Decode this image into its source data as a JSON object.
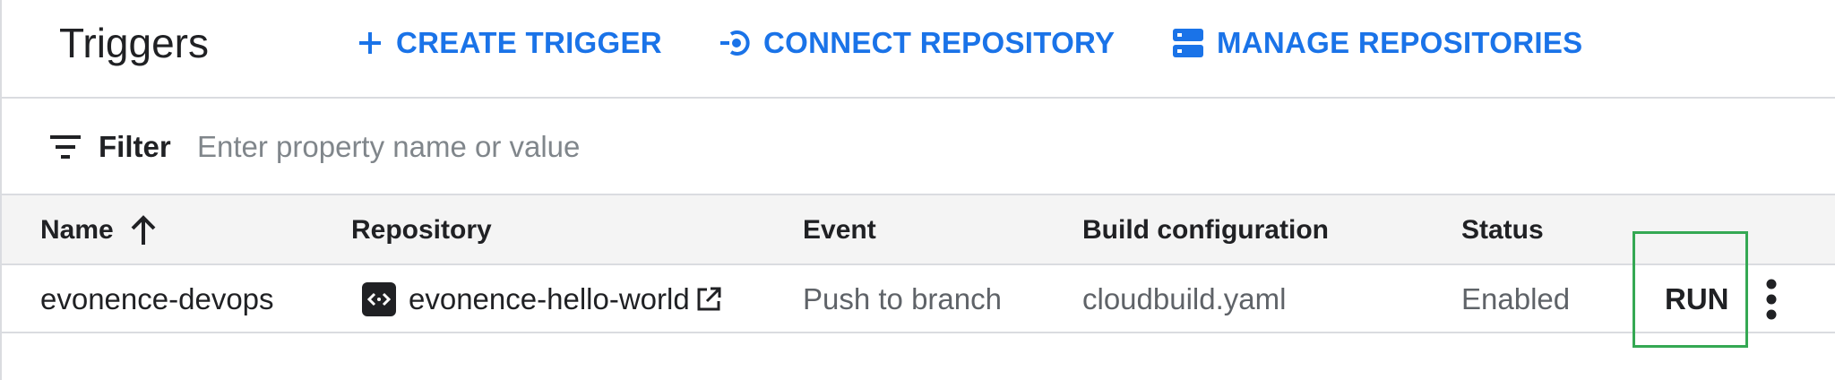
{
  "header": {
    "title": "Triggers",
    "create_label": "CREATE TRIGGER",
    "connect_label": "CONNECT REPOSITORY",
    "manage_label": "MANAGE REPOSITORIES",
    "accent_color": "#1a73e8"
  },
  "filter": {
    "label": "Filter",
    "placeholder": "Enter property name or value",
    "value": ""
  },
  "table": {
    "columns": {
      "name": "Name",
      "repository": "Repository",
      "event": "Event",
      "build_configuration": "Build configuration",
      "status": "Status"
    },
    "sort": {
      "column": "Name",
      "direction": "ascending"
    },
    "rows": [
      {
        "name": "evonence-devops",
        "repository": "evonence-hello-world",
        "event": "Push to branch",
        "build_configuration": "cloudbuild.yaml",
        "status": "Enabled",
        "run_label": "RUN"
      }
    ]
  },
  "highlight_color": "#34a853"
}
